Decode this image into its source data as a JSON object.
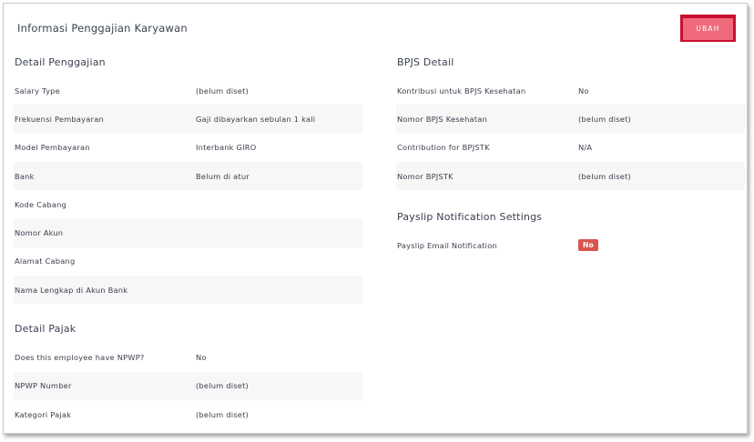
{
  "card": {
    "title": "Informasi Penggajian Karyawan",
    "edit_label": "UBAH"
  },
  "salary": {
    "title": "Detail Penggajian",
    "rows": [
      {
        "label": "Salary Type",
        "value": "(belum diset)"
      },
      {
        "label": "Frekuensi Pembayaran",
        "value": "Gaji dibayarkan sebulan 1 kali"
      },
      {
        "label": "Model Pembayaran",
        "value": "Interbank GIRO"
      },
      {
        "label": "Bank",
        "value": "Belum di atur"
      },
      {
        "label": "Kode Cabang",
        "value": ""
      },
      {
        "label": "Nomor Akun",
        "value": ""
      },
      {
        "label": "Alamat Cabang",
        "value": ""
      },
      {
        "label": "Nama Lengkap di Akun Bank",
        "value": ""
      }
    ]
  },
  "tax": {
    "title": "Detail Pajak",
    "rows": [
      {
        "label": "Does this employee have NPWP?",
        "value": "No"
      },
      {
        "label": "NPWP Number",
        "value": "(belum diset)"
      },
      {
        "label": "Kategori Pajak",
        "value": "(belum diset)"
      }
    ]
  },
  "bpjs": {
    "title": "BPJS Detail",
    "rows": [
      {
        "label": "Kontribusi untuk BPJS Kesehatan",
        "value": "No"
      },
      {
        "label": "Nomor BPJS Kesehatan",
        "value": "(belum diset)"
      },
      {
        "label": "Contribution for BPJSTK",
        "value": "N/A"
      },
      {
        "label": "Nomor BPJSTK",
        "value": "(belum diset)"
      }
    ]
  },
  "payslip": {
    "title": "Payslip Notification Settings",
    "rows": [
      {
        "label": "Payslip Email Notification",
        "value": "No",
        "badge_color": "#d9534f"
      }
    ]
  },
  "colors": {
    "accent": "#c8102e",
    "button": "#f06a7d",
    "badge": "#d9534f"
  }
}
